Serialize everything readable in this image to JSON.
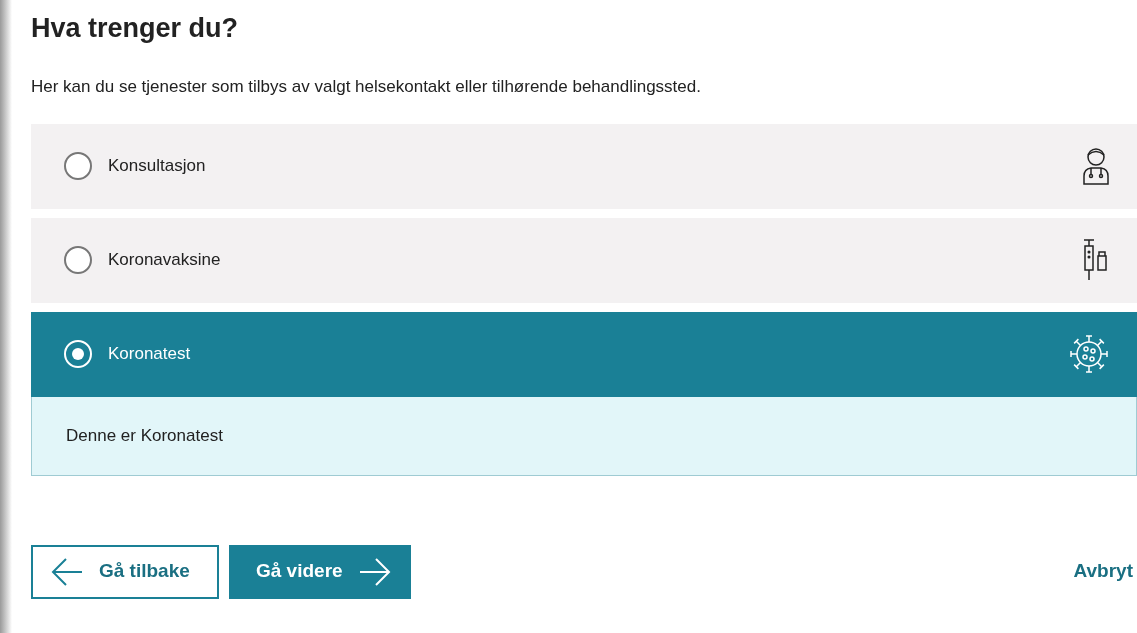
{
  "heading": "Hva trenger du?",
  "intro": "Her kan du se tjenester som tilbys av valgt helsekontakt eller tilhørende behandlingssted.",
  "options": [
    {
      "label": "Konsultasjon",
      "kind": "doctor",
      "selected": false
    },
    {
      "label": "Koronavaksine",
      "kind": "vaccine",
      "selected": false
    },
    {
      "label": "Koronatest",
      "kind": "virus",
      "selected": true,
      "detail": "Denne er Koronatest"
    }
  ],
  "buttons": {
    "back": "Gå tilbake",
    "next": "Gå videre",
    "cancel": "Avbryt"
  }
}
